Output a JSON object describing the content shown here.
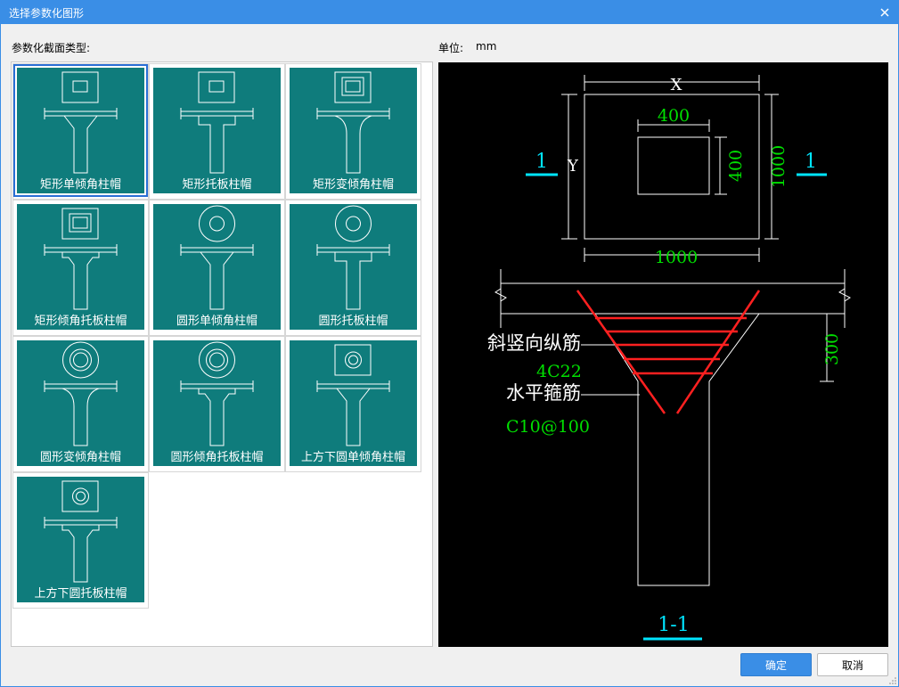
{
  "window": {
    "title": "选择参数化图形"
  },
  "labels": {
    "section_type": "参数化截面类型:",
    "unit_label": "单位:",
    "unit_value": "mm"
  },
  "gallery": {
    "selected_index": 0,
    "items": [
      {
        "label": "矩形单倾角柱帽",
        "top": "rect",
        "cap": "single"
      },
      {
        "label": "矩形托板柱帽",
        "top": "rect",
        "cap": "plate"
      },
      {
        "label": "矩形变倾角柱帽",
        "top": "rect-double",
        "cap": "variable"
      },
      {
        "label": "矩形倾角托板柱帽",
        "top": "rect-double",
        "cap": "incline-plate"
      },
      {
        "label": "圆形单倾角柱帽",
        "top": "circle",
        "cap": "single"
      },
      {
        "label": "圆形托板柱帽",
        "top": "circle",
        "cap": "plate"
      },
      {
        "label": "圆形变倾角柱帽",
        "top": "circle-double",
        "cap": "variable"
      },
      {
        "label": "圆形倾角托板柱帽",
        "top": "circle-double",
        "cap": "incline-plate"
      },
      {
        "label": "上方下圆单倾角柱帽",
        "top": "rect-circle",
        "cap": "single"
      },
      {
        "label": "上方下圆托板柱帽",
        "top": "rect-circle",
        "cap": "incline-plate"
      }
    ]
  },
  "preview": {
    "plan": {
      "x_label": "X",
      "y_label": "Y",
      "hole_width": "400",
      "hole_height": "400",
      "outer_height": "1000",
      "outer_width": "1000",
      "section_mark": "1"
    },
    "section": {
      "cap_depth": "300",
      "label_vertical_bars": "斜竖向纵筋",
      "vertical_bars_spec": "4C22",
      "label_stirrups": "水平箍筋",
      "stirrups_spec": "C10@100",
      "section_title": "1-1"
    },
    "colors": {
      "background": "#000000",
      "lines": "#ffffff",
      "dims": "#00e000",
      "marks": "#00e5ff",
      "rebar": "#ff2020"
    }
  },
  "buttons": {
    "ok": "确定",
    "cancel": "取消"
  }
}
